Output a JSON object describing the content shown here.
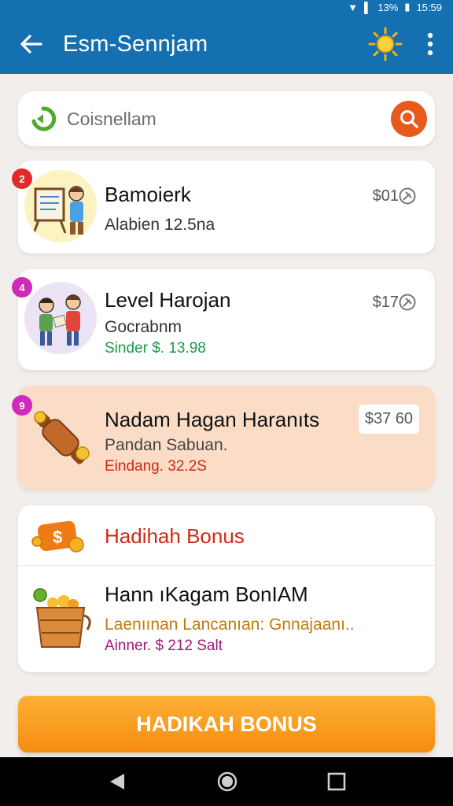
{
  "status": {
    "time": "15:59",
    "battery": "13%"
  },
  "header": {
    "title": "Esm-Sennjam"
  },
  "search": {
    "placeholder": "Coisnellam"
  },
  "items": [
    {
      "badge": "2",
      "title": "Bamoierk",
      "subtitle": "Alabien 12.5na",
      "line3": "",
      "price": "$01"
    },
    {
      "badge": "4",
      "title": "Level Harojan",
      "subtitle": "Gocrabnm",
      "line3": "Sinder $. 13.98",
      "price": "$17"
    },
    {
      "badge": "9",
      "title": "Nadam Hagan Haranıts",
      "subtitle": "Pandan Sabuan.",
      "line3": "Eindang. 32.2S",
      "price": "$37 60"
    }
  ],
  "bonus": {
    "header": "Hadihah Bonus",
    "title": "Hann ıKagam BonIAM",
    "subtitle": "Laenıınan Lancanıan: Gnnajaanı..",
    "line3": "Ainner. $ 212 Salt"
  },
  "cta": {
    "label": "HADIKAH BONUS"
  },
  "colors": {
    "appbar": "#1470b0",
    "accent": "#f58d12",
    "search_button": "#e85a1c",
    "green": "#1a9a4a",
    "red": "#cf2a16",
    "purple": "#a0197a"
  }
}
